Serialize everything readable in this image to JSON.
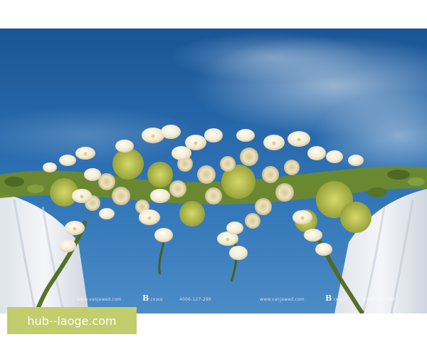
{
  "photo": {
    "subject": "wedding floral arch against a blue sky",
    "watermarks": [
      {
        "id": "site_left",
        "text": "www.vanjawed.com"
      },
      {
        "id": "logo_left",
        "text": "B",
        "sub": "INHE"
      },
      {
        "id": "phone_left",
        "text": "4006-127-299"
      },
      {
        "id": "site_right",
        "text": "www.vanjawed.com"
      },
      {
        "id": "logo_right",
        "text": "B",
        "sub": "INHE"
      },
      {
        "id": "phone_right",
        "text": "4006-127-299"
      }
    ]
  },
  "badge": {
    "text": "hub--laoge.com",
    "bg_color": "#c2cd6c",
    "text_color": "#ffffff"
  },
  "colors": {
    "sky_top": "#1e5fa0",
    "sky_bottom": "#3b7fc0",
    "flowers_white": "#f6f1e2",
    "flowers_cream": "#e8dfbf",
    "greenery": "#7d8a2a",
    "drape": "#eef0f5"
  }
}
